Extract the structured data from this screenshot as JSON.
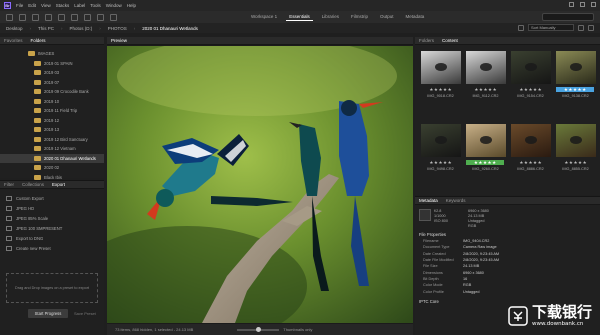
{
  "menu": {
    "items": [
      "File",
      "Edit",
      "View",
      "Stacks",
      "Label",
      "Tools",
      "Window",
      "Help"
    ]
  },
  "workspaces": [
    "Workspace 1",
    "Essentials",
    "Libraries",
    "Filmstrip",
    "Output",
    "Metadata"
  ],
  "active_workspace": "Essentials",
  "path": {
    "crumbs": [
      "Desktop",
      "This PC",
      "Photos (D:)",
      "PHOTOS",
      "2020 01 Dhanauri Wetlands"
    ]
  },
  "sort": {
    "value": "Sort Manually"
  },
  "left_top": {
    "tabs": [
      "Favorites",
      "Folders"
    ],
    "active_tab": "Folders",
    "folders": [
      "IMAGES",
      "2019 01 SPAIN",
      "2019 03",
      "2019 07",
      "2019 09 Crocodile Bank",
      "2019 10",
      "2019 11 Field Trip",
      "2019 12",
      "2019 13",
      "2019 12 Bird Sanctuary",
      "2019 12 Vietnam",
      "2020 01 Dhanauri Wetlands",
      "2020 02",
      "Black Ibis"
    ],
    "selected_folder": "2020 01 Dhanauri Wetlands"
  },
  "left_bottom": {
    "tabs": [
      "Filter",
      "Collections",
      "Export"
    ],
    "active_tab": "Export",
    "items": [
      "Custom Export",
      "JPEG HD",
      "JPEG 85% Scale",
      "JPEG 100 SMPRESENT",
      "Export to DNG",
      "Create new Preset"
    ],
    "drop_hint": "Drag and Drop images on a preset to export",
    "start_label": "Start Progress",
    "save_label": "Save Preset"
  },
  "preview": {
    "tab": "Preview",
    "status": "73 items, 868 hidden, 1 selected - 24.13 MB",
    "zoom_fraction": 0.45,
    "thumbs_label": "Thumbnails only"
  },
  "right_top": {
    "tabs": [
      "Folders",
      "Content"
    ],
    "active_tab": "Content",
    "thumbnails": [
      {
        "name": "IMG_9018.CR2",
        "label": "",
        "stars": 5,
        "scene": "light"
      },
      {
        "name": "IMG_9112.CR2",
        "label": "",
        "stars": 5,
        "scene": "light"
      },
      {
        "name": "IMG_9154.CR2",
        "label": "",
        "stars": 5,
        "scene": "dark"
      },
      {
        "name": "IMG_9138.CR2",
        "label": "blue",
        "stars": 5,
        "scene": "olive"
      },
      {
        "name": "IMG_9498.CR2",
        "label": "",
        "stars": 5,
        "scene": "dark"
      },
      {
        "name": "IMG_9260.CR2",
        "label": "green",
        "stars": 5,
        "scene": "tan"
      },
      {
        "name": "IMG_8886.CR2",
        "label": "",
        "stars": 5,
        "scene": "brown"
      },
      {
        "name": "IMG_8855.CR2",
        "label": "",
        "stars": 5,
        "scene": "green"
      }
    ]
  },
  "right_bottom": {
    "tabs": [
      "Metadata",
      "Keywords"
    ],
    "active_tab": "Metadata",
    "exposure": {
      "aperture": "f/2.8",
      "shutter": "1/1000",
      "iso": "ISO 800",
      "resolution": "6960 x 3680",
      "size": "24.13 MB",
      "color": "RGB",
      "tag": "Untagged"
    },
    "section_file": "File Properties",
    "rows": [
      {
        "k": "Filename",
        "v": "IMG_9404.CR2"
      },
      {
        "k": "Document Type",
        "v": "Camera Raw image"
      },
      {
        "k": "Date Created",
        "v": "2/8/2020, 9:23:45 AM"
      },
      {
        "k": "Date File Modified",
        "v": "2/8/2020, 9:23:45 AM"
      },
      {
        "k": "File Size",
        "v": "24.13 MB"
      },
      {
        "k": "Dimensions",
        "v": "6960 x 3680"
      },
      {
        "k": "Bit Depth",
        "v": "16"
      },
      {
        "k": "Color Mode",
        "v": "RGB"
      },
      {
        "k": "Color Profile",
        "v": "Untagged"
      }
    ],
    "section_iptc": "IPTC Core"
  },
  "watermark": {
    "title": "下载银行",
    "subtitle": "www.downbank.cn"
  },
  "colors": {
    "folder_accent": "#c9a34a",
    "green_label": "#4fae4f",
    "blue_label": "#4aa3e0"
  }
}
